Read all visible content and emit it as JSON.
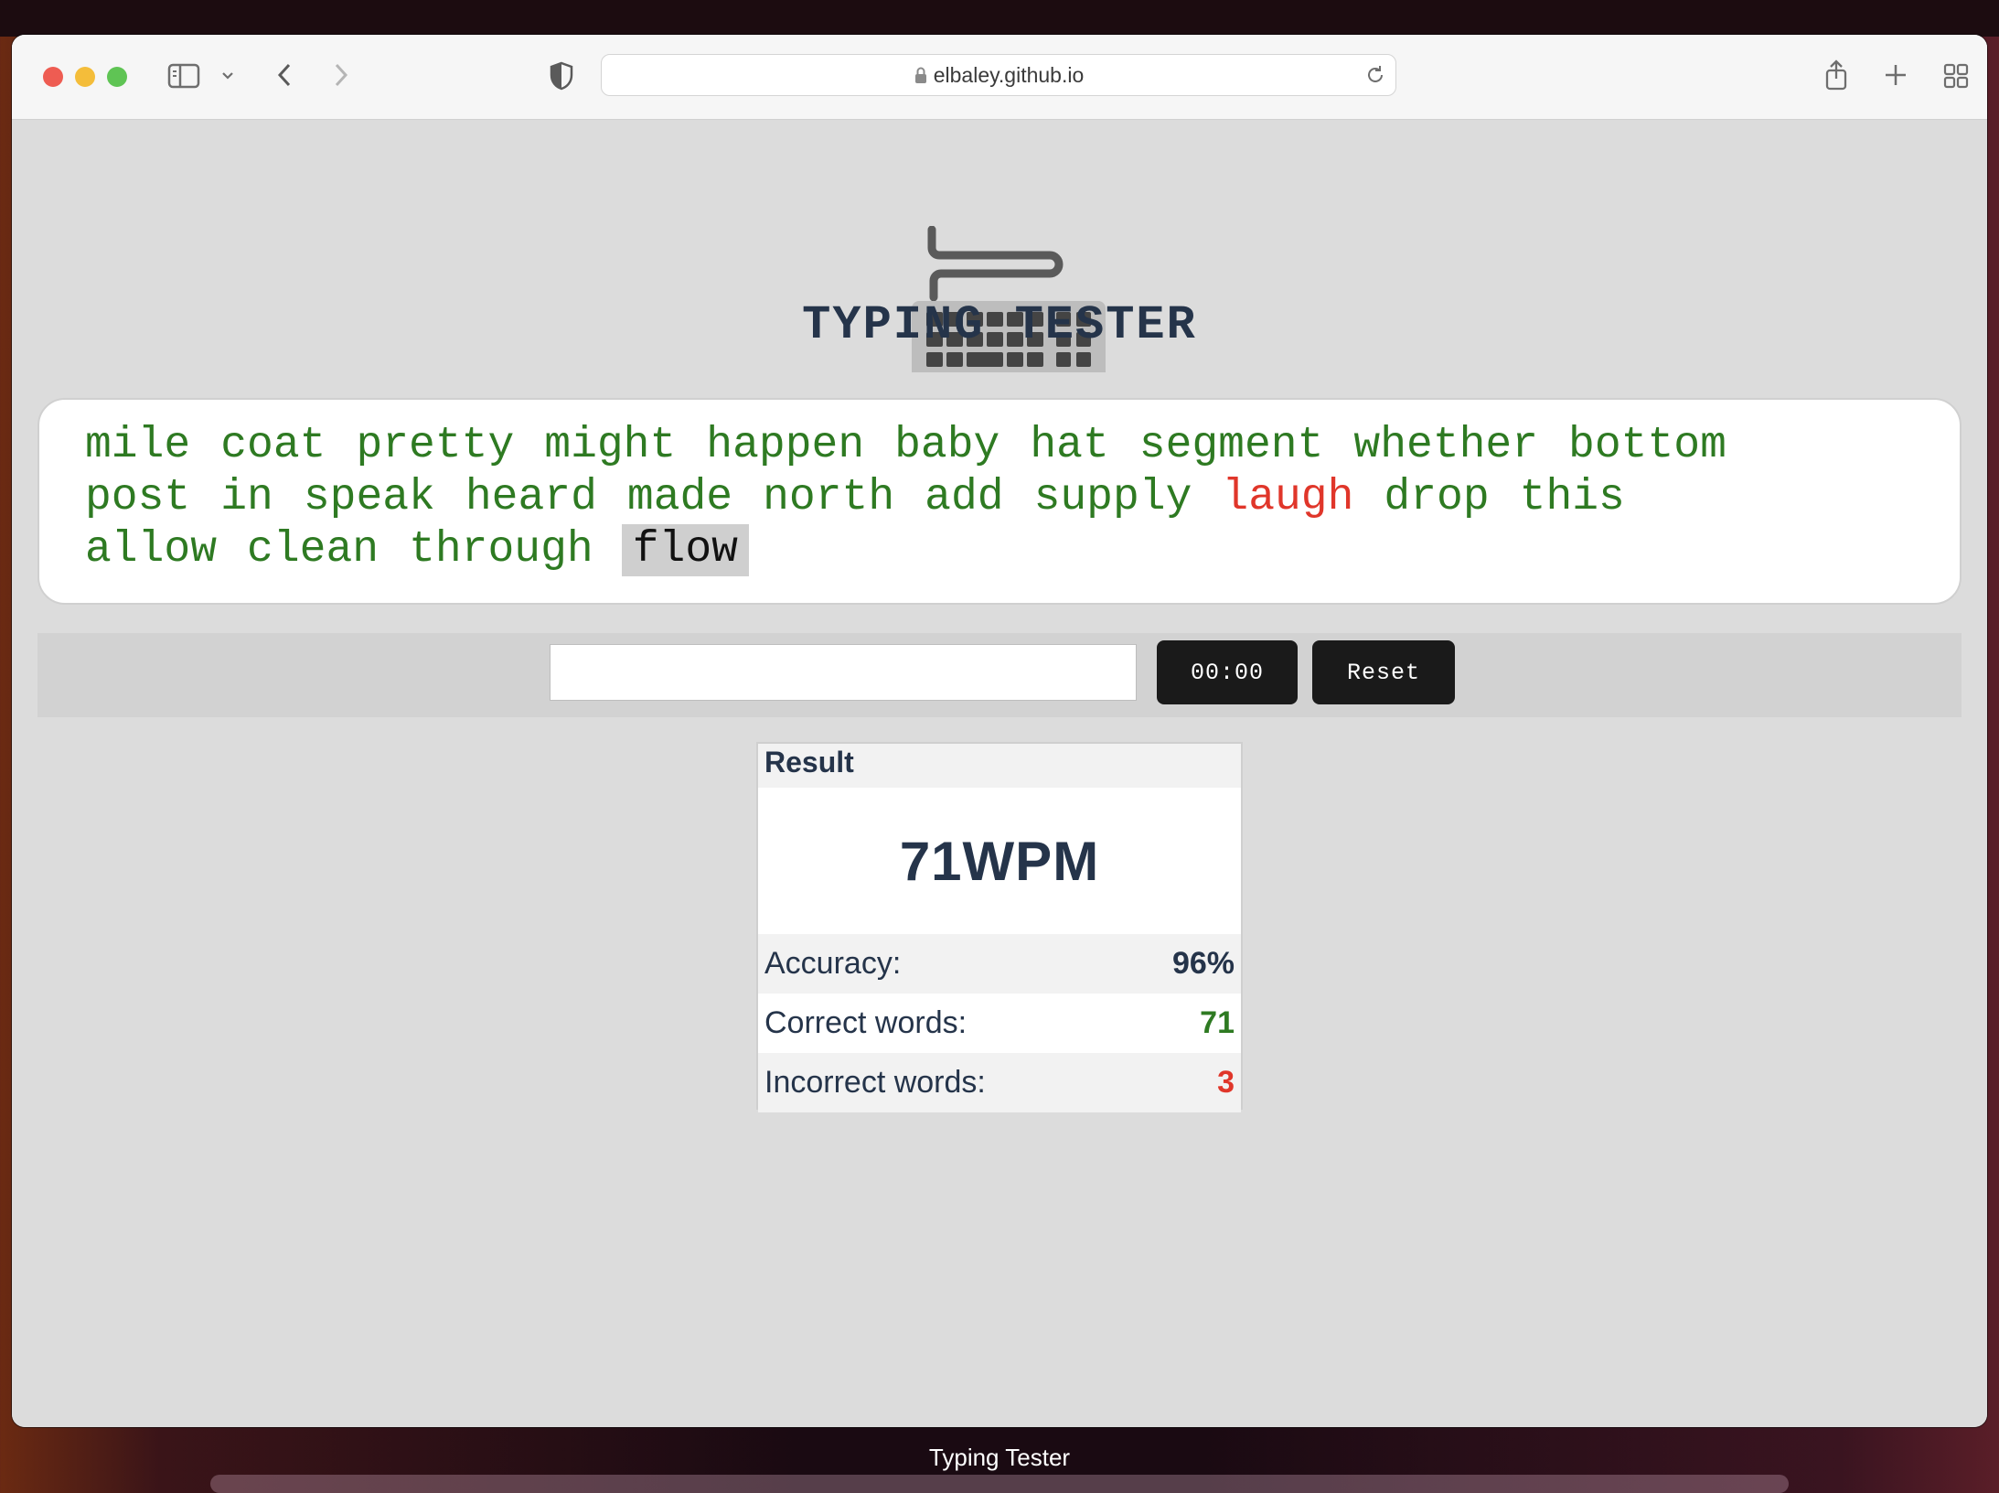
{
  "browser": {
    "url": "elbaley.github.io",
    "tab_caption": "Typing Tester"
  },
  "app": {
    "title": "TYPING TESTER",
    "logo_icon": "keyboard-icon"
  },
  "words": {
    "lines": [
      [
        {
          "text": "mile",
          "state": "correct"
        },
        {
          "text": "coat",
          "state": "correct"
        },
        {
          "text": "pretty",
          "state": "correct"
        },
        {
          "text": "might",
          "state": "correct"
        },
        {
          "text": "happen",
          "state": "correct"
        },
        {
          "text": "baby",
          "state": "correct"
        },
        {
          "text": "hat",
          "state": "correct"
        },
        {
          "text": "segment",
          "state": "correct"
        },
        {
          "text": "whether",
          "state": "correct"
        },
        {
          "text": "bottom",
          "state": "correct"
        }
      ],
      [
        {
          "text": "post",
          "state": "correct"
        },
        {
          "text": "in",
          "state": "correct"
        },
        {
          "text": "speak",
          "state": "correct"
        },
        {
          "text": "heard",
          "state": "correct"
        },
        {
          "text": "made",
          "state": "correct"
        },
        {
          "text": "north",
          "state": "correct"
        },
        {
          "text": "add",
          "state": "correct"
        },
        {
          "text": "supply",
          "state": "correct"
        },
        {
          "text": "laugh",
          "state": "wrong"
        },
        {
          "text": "drop",
          "state": "correct"
        },
        {
          "text": "this",
          "state": "correct"
        }
      ],
      [
        {
          "text": "allow",
          "state": "correct"
        },
        {
          "text": "clean",
          "state": "correct"
        },
        {
          "text": "through",
          "state": "correct"
        },
        {
          "text": "flow",
          "state": "current"
        }
      ]
    ]
  },
  "controls": {
    "input_value": "",
    "timer": "00:00",
    "reset_label": "Reset"
  },
  "result": {
    "heading": "Result",
    "wpm": "71WPM",
    "accuracy_label": "Accuracy:",
    "accuracy_value": "96%",
    "correct_label": "Correct words:",
    "correct_value": "71",
    "incorrect_label": "Incorrect words:",
    "incorrect_value": "3"
  },
  "colors": {
    "correct": "#2e7a22",
    "wrong": "#e0362a",
    "title": "#25344a"
  }
}
